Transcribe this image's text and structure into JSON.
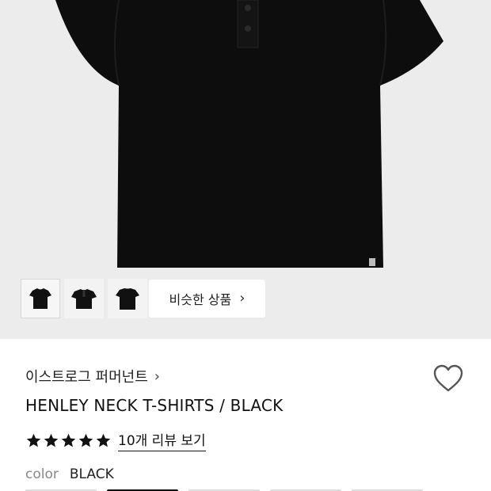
{
  "gallery": {
    "thumbnails": [
      {
        "name": "front-view"
      },
      {
        "name": "detail-view"
      },
      {
        "name": "back-view"
      }
    ],
    "similar_button": {
      "label": "비슷한 상품",
      "chevron": "›"
    }
  },
  "product": {
    "brand": "이스트로그 퍼머넌트",
    "brand_chevron": "›",
    "title": "HENLEY NECK T-SHIRTS / BLACK",
    "rating_stars": 5,
    "review_link": "10개 리뷰 보기",
    "color_label": "color",
    "color_value": "BLACK"
  },
  "colors": {
    "shirt": "#0d0d0d",
    "background": "#ececec",
    "star": "#111111"
  }
}
